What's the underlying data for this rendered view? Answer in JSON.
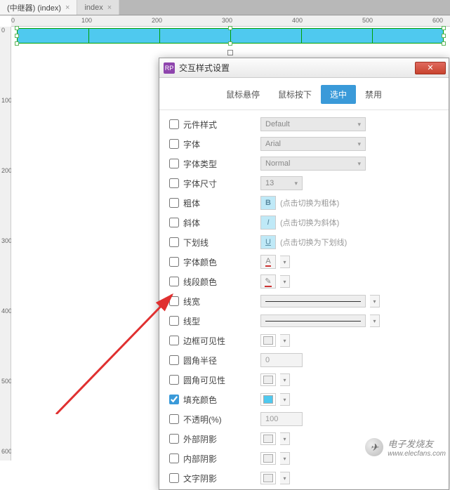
{
  "tabs": [
    {
      "label": "(中继器) (index)",
      "active": true
    },
    {
      "label": "index",
      "active": false
    }
  ],
  "ruler_h": [
    "0",
    "100",
    "200",
    "300",
    "400",
    "500",
    "600"
  ],
  "ruler_v": [
    "0",
    "100",
    "200",
    "300",
    "400",
    "500",
    "600"
  ],
  "dialog": {
    "title": "交互样式设置",
    "badge": "RP",
    "tabs": {
      "hover": "鼠标悬停",
      "mousedown": "鼠标按下",
      "selected": "选中",
      "disabled": "禁用"
    },
    "active_tab": "selected",
    "props": {
      "widget_style": {
        "label": "元件样式",
        "value": "Default"
      },
      "font": {
        "label": "字体",
        "value": "Arial"
      },
      "font_type": {
        "label": "字体类型",
        "value": "Normal"
      },
      "font_size": {
        "label": "字体尺寸",
        "value": "13"
      },
      "bold": {
        "label": "粗体",
        "icon": "B",
        "hint": "(点击切换为粗体)"
      },
      "italic": {
        "label": "斜体",
        "icon": "I",
        "hint": "(点击切换为斜体)"
      },
      "underline": {
        "label": "下划线",
        "icon": "U",
        "hint": "(点击切换为下划线)"
      },
      "font_color": {
        "label": "字体颜色"
      },
      "line_color": {
        "label": "线段颜色"
      },
      "line_width": {
        "label": "线宽"
      },
      "line_style": {
        "label": "线型"
      },
      "border_vis": {
        "label": "边框可见性"
      },
      "corner_radius": {
        "label": "圆角半径",
        "value": "0"
      },
      "corner_vis": {
        "label": "圆角可见性"
      },
      "fill_color": {
        "label": "填充颜色",
        "checked": true,
        "color": "#4fc9ef"
      },
      "opacity": {
        "label": "不透明(%)",
        "value": "100"
      },
      "outer_shadow": {
        "label": "外部阴影"
      },
      "inner_shadow": {
        "label": "内部阴影"
      },
      "text_shadow": {
        "label": "文字阴影"
      }
    }
  },
  "watermark": {
    "text": "电子发烧友",
    "url": "www.elecfans.com"
  }
}
